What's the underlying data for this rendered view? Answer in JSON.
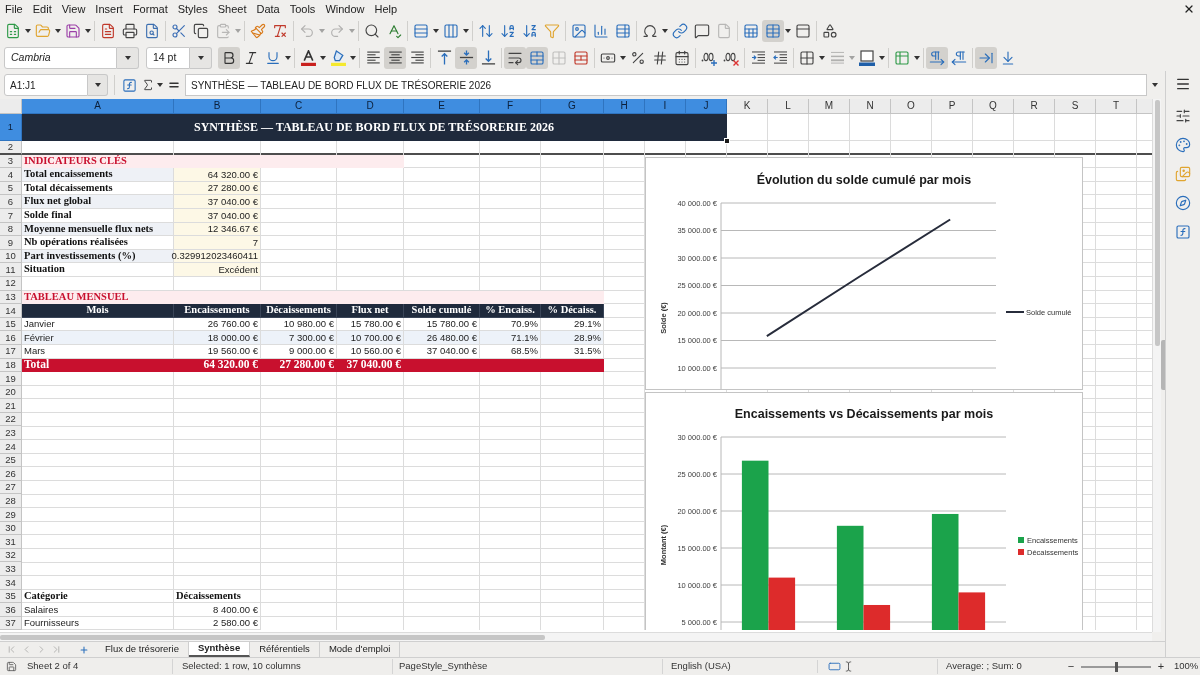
{
  "menu_bar": {
    "items": [
      "File",
      "Edit",
      "View",
      "Insert",
      "Format",
      "Styles",
      "Sheet",
      "Data",
      "Tools",
      "Window",
      "Help"
    ]
  },
  "standard_toolbar": {
    "paste": {
      "disabled": true
    },
    "undo": {
      "disabled": true
    },
    "redo": {
      "disabled": true
    },
    "header_footer": {
      "disabled": true
    },
    "freeze_rows_columns": {
      "active": true
    }
  },
  "formatting_toolbar": {
    "font_name": "Cambria",
    "font_size": "14 pt",
    "bold": {
      "active": true
    },
    "italic": {
      "active": false
    },
    "underline": {
      "active": false
    },
    "align_left": {
      "active": false
    },
    "align_center": {
      "active": true
    },
    "align_right": {
      "active": false
    },
    "align_top": {
      "active": false
    },
    "align_middle": {
      "active": true
    },
    "align_bottom": {
      "active": false
    },
    "wrap_text": {
      "active": true
    },
    "merge_and_center": {
      "active": true
    },
    "merge_cells": {
      "disabled": true
    },
    "border_style": {
      "disabled": true
    },
    "left_to_right": {
      "active": true
    },
    "right_to_left": {
      "active": false
    },
    "text_horizontal": {
      "active": true
    },
    "text_vertical": {
      "active": false
    }
  },
  "formula_bar": {
    "name_box": "A1:J1",
    "formula": "SYNTHÈSE — TABLEAU DE BORD FLUX DE TRÉSORERIE 2026"
  },
  "sheet": {
    "columns": [
      {
        "label": "A",
        "selected": true
      },
      {
        "label": "B",
        "selected": true
      },
      {
        "label": "C",
        "selected": true
      },
      {
        "label": "D",
        "selected": true
      },
      {
        "label": "E",
        "selected": true
      },
      {
        "label": "F",
        "selected": true
      },
      {
        "label": "G",
        "selected": true
      },
      {
        "label": "H",
        "selected": true
      },
      {
        "label": "I",
        "selected": true
      },
      {
        "label": "J",
        "selected": true
      },
      {
        "label": "K",
        "selected": false
      },
      {
        "label": "L",
        "selected": false
      },
      {
        "label": "M",
        "selected": false
      },
      {
        "label": "N",
        "selected": false
      },
      {
        "label": "O",
        "selected": false
      },
      {
        "label": "P",
        "selected": false
      },
      {
        "label": "Q",
        "selected": false
      },
      {
        "label": "R",
        "selected": false
      },
      {
        "label": "S",
        "selected": false
      },
      {
        "label": "T",
        "selected": false
      }
    ],
    "rows": [
      {
        "number": "1",
        "selected": true,
        "kind": "title",
        "cells": [
          "SYNTHÈSE — TABLEAU DE BORD FLUX DE TRÉSORERIE 2026"
        ]
      },
      {
        "number": "2",
        "selected": false,
        "kind": "blank"
      },
      {
        "number": "3",
        "selected": false,
        "kind": "section",
        "cells": [
          "INDICATEURS CLÉS"
        ]
      },
      {
        "number": "4",
        "selected": false,
        "kind": "kpi",
        "shaded": true,
        "cells": [
          "Total encaissements",
          "64 320.00 €"
        ]
      },
      {
        "number": "5",
        "selected": false,
        "kind": "kpi",
        "shaded": false,
        "cells": [
          "Total décaissements",
          "27 280.00 €"
        ]
      },
      {
        "number": "6",
        "selected": false,
        "kind": "kpi",
        "shaded": true,
        "cells": [
          "Flux net global",
          "37 040.00 €"
        ]
      },
      {
        "number": "7",
        "selected": false,
        "kind": "kpi",
        "shaded": false,
        "cells": [
          "Solde final",
          "37 040.00 €"
        ]
      },
      {
        "number": "8",
        "selected": false,
        "kind": "kpi",
        "shaded": true,
        "cells": [
          "Moyenne mensuelle flux nets",
          "12 346.67 €"
        ]
      },
      {
        "number": "9",
        "selected": false,
        "kind": "kpi",
        "shaded": false,
        "cells": [
          "Nb opérations réalisées",
          "7"
        ]
      },
      {
        "number": "10",
        "selected": false,
        "kind": "kpi",
        "shaded": true,
        "cells": [
          "Part investissements (%)",
          "0.329912023460411"
        ]
      },
      {
        "number": "11",
        "selected": false,
        "kind": "kpi",
        "shaded": false,
        "cells": [
          "Situation",
          "Excédent"
        ]
      },
      {
        "number": "12",
        "selected": false,
        "kind": "blank"
      },
      {
        "number": "13",
        "selected": false,
        "kind": "section",
        "cells": [
          "TABLEAU MENSUEL"
        ]
      },
      {
        "number": "14",
        "selected": false,
        "kind": "table_header",
        "cells": [
          "Mois",
          "Encaissements",
          "Décaissements",
          "Flux net",
          "Solde cumulé",
          "% Encaiss.",
          "% Décaiss."
        ]
      },
      {
        "number": "15",
        "selected": false,
        "kind": "table_row",
        "shaded": false,
        "cells": [
          "Janvier",
          "26 760.00 €",
          "10 980.00 €",
          "15 780.00 €",
          "15 780.00 €",
          "70.9%",
          "29.1%"
        ]
      },
      {
        "number": "16",
        "selected": false,
        "kind": "table_row",
        "shaded": true,
        "cells": [
          "Février",
          "18 000.00 €",
          "7 300.00 €",
          "10 700.00 €",
          "26 480.00 €",
          "71.1%",
          "28.9%"
        ]
      },
      {
        "number": "17",
        "selected": false,
        "kind": "table_row",
        "shaded": false,
        "cells": [
          "Mars",
          "19 560.00 €",
          "9 000.00 €",
          "10 560.00 €",
          "37 040.00 €",
          "68.5%",
          "31.5%"
        ]
      },
      {
        "number": "18",
        "selected": false,
        "kind": "table_total",
        "cells": [
          "Total",
          "64 320.00 €",
          "27 280.00 €",
          "37 040.00 €"
        ]
      },
      {
        "number": "19",
        "selected": false,
        "kind": "blank"
      },
      {
        "number": "20",
        "selected": false,
        "kind": "blank"
      },
      {
        "number": "21",
        "selected": false,
        "kind": "blank"
      },
      {
        "number": "22",
        "selected": false,
        "kind": "blank"
      },
      {
        "number": "23",
        "selected": false,
        "kind": "blank"
      },
      {
        "number": "24",
        "selected": false,
        "kind": "blank"
      },
      {
        "number": "25",
        "selected": false,
        "kind": "blank"
      },
      {
        "number": "26",
        "selected": false,
        "kind": "blank"
      },
      {
        "number": "27",
        "selected": false,
        "kind": "blank"
      },
      {
        "number": "28",
        "selected": false,
        "kind": "blank"
      },
      {
        "number": "29",
        "selected": false,
        "kind": "blank"
      },
      {
        "number": "30",
        "selected": false,
        "kind": "blank"
      },
      {
        "number": "31",
        "selected": false,
        "kind": "blank"
      },
      {
        "number": "32",
        "selected": false,
        "kind": "blank"
      },
      {
        "number": "33",
        "selected": false,
        "kind": "blank"
      },
      {
        "number": "34",
        "selected": false,
        "kind": "blank"
      },
      {
        "number": "35",
        "selected": false,
        "kind": "list_header",
        "cells": [
          "Catégorie",
          "Décaissements"
        ]
      },
      {
        "number": "36",
        "selected": false,
        "kind": "list_row",
        "cells": [
          "Salaires",
          "8 400.00 €"
        ]
      },
      {
        "number": "37",
        "selected": false,
        "kind": "list_row",
        "cells": [
          "Fournisseurs",
          "2 580.00 €"
        ]
      }
    ],
    "charts": [
      {
        "chart_data": {
          "type": "line",
          "title": "Évolution du solde cumulé par mois",
          "ylabel": "Solde (€)",
          "ylim": [
            10000,
            40000
          ],
          "yticks": [
            {
              "value": 40000,
              "label": "40 000.00 €"
            },
            {
              "value": 35000,
              "label": "35 000.00 €"
            },
            {
              "value": 30000,
              "label": "30 000.00 €"
            },
            {
              "value": 25000,
              "label": "25 000.00 €"
            },
            {
              "value": 20000,
              "label": "20 000.00 €"
            },
            {
              "value": 15000,
              "label": "15 000.00 €"
            },
            {
              "value": 10000,
              "label": "10 000.00 €"
            }
          ],
          "grid": true,
          "legend": true,
          "series": [
            {
              "name": "Solde cumulé",
              "color": "#272c3b",
              "values": [
                15800,
                26500,
                37000
              ]
            }
          ]
        }
      },
      {
        "chart_data": {
          "type": "bar",
          "title": "Encaissements vs Décaissements par mois",
          "ylabel": "Montant (€)",
          "ylim": [
            5000,
            30000
          ],
          "yticks": [
            {
              "value": 30000,
              "label": "30 000.00 €"
            },
            {
              "value": 25000,
              "label": "25 000.00 €"
            },
            {
              "value": 20000,
              "label": "20 000.00 €"
            },
            {
              "value": 15000,
              "label": "15 000.00 €"
            },
            {
              "value": 10000,
              "label": "10 000.00 €"
            },
            {
              "value": 5000,
              "label": "5 000.00 €"
            }
          ],
          "grid": true,
          "legend": true,
          "series": [
            {
              "name": "Encaissements",
              "color": "#1ba34b",
              "values": [
                26800,
                18000,
                19600
              ]
            },
            {
              "name": "Décaissements",
              "color": "#dd2b2b",
              "values": [
                11000,
                7300,
                9000
              ]
            }
          ]
        }
      }
    ]
  },
  "sheet_tabs": [
    {
      "label": "Flux de trésorerie",
      "selected": false
    },
    {
      "label": "Synthèse",
      "selected": true
    },
    {
      "label": "Référentiels",
      "selected": false
    },
    {
      "label": "Mode d'emploi",
      "selected": false
    }
  ],
  "status_bar": {
    "sheet_position": "Sheet 2 of 4",
    "selection": "Selected: 1 row, 10 columns",
    "page_style": "PageStyle_Synthèse",
    "language": "English (USA)",
    "summary": "Average: ; Sum: 0",
    "zoom_out": "−",
    "zoom_slider": {
      "level": 0.5
    },
    "zoom_in": "+",
    "zoom": "100%"
  }
}
